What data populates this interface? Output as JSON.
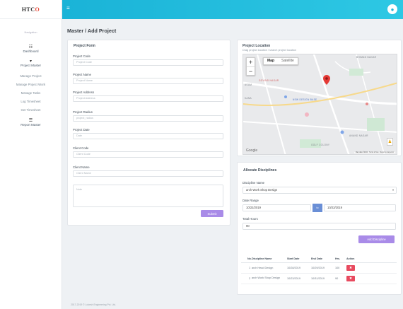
{
  "brand": {
    "prefix": "HTC",
    "accent": "O"
  },
  "sidebar": {
    "heading": "Navigation",
    "items": [
      {
        "label": "Dashboard",
        "icon": "dashboard-icon"
      },
      {
        "label": "Project Master",
        "icon": "project-icon"
      }
    ],
    "sub_items": [
      "Manage Project",
      "Manage Project Work",
      "Manage Tasks",
      "Log Timesheet",
      "Get Timesheet"
    ],
    "bottom_item": {
      "label": "Report Master",
      "icon": "report-icon"
    }
  },
  "page": {
    "title": "Master / Add Project"
  },
  "project_form": {
    "title": "Project Form",
    "fields": [
      {
        "label": "Project Code",
        "placeholder": "Project Code"
      },
      {
        "label": "Project Name",
        "placeholder": "Project Name"
      },
      {
        "label": "Project Address",
        "placeholder": "Project Address"
      },
      {
        "label": "Project Radius",
        "placeholder": "project_radius"
      },
      {
        "label": "Project Date",
        "placeholder": "Date"
      },
      {
        "label": "Client Code",
        "placeholder": "Client Code"
      },
      {
        "label": "Client Name",
        "placeholder": "Client Name"
      }
    ],
    "notes_placeholder": "Note",
    "submit_label": "Submit"
  },
  "location": {
    "title": "Project Location",
    "subtitle": "Drag project location / search project location",
    "map_type": {
      "active": "Map",
      "inactive": "Satellite"
    },
    "zoom_in": "+",
    "zoom_out": "−",
    "labels": [
      "BHIMAN NAGAR",
      "ANAND NAGAR",
      "KANA",
      "ASAM",
      "GOVIND NAGAR",
      "NEW DESIGN BASE",
      "GOLF COLONY"
    ],
    "google": "Google",
    "footer_text": "Map data ©2024 · Terms of Use · Report a map error"
  },
  "allocate": {
    "title": "Allocate Disciplines",
    "discipline_label": "Discipline Name",
    "discipline_value": "arch Work Shop Design",
    "date_range_label": "Date Range",
    "start_date": "10/22/2019",
    "to_label": "to",
    "end_date": "10/23/2019",
    "total_hours_label": "Total Hours",
    "total_hours_value": "90",
    "add_button": "Add Discipline",
    "table": {
      "headers": [
        "No.",
        "Discipline Name",
        "Start Date",
        "End Date",
        "Hrs.",
        "Action"
      ],
      "rows": [
        {
          "no": "1",
          "name": "arch Head Design",
          "start": "10/28/2019",
          "end": "10/29/2019",
          "hrs": "100"
        },
        {
          "no": "2",
          "name": "arch Work Shop Design",
          "start": "10/23/2019",
          "end": "10/31/2019",
          "hrs": "90"
        }
      ],
      "delete_symbol": "✖"
    }
  },
  "footer": {
    "text": "2017-2019 © Lokesh Engineering Pvt. Ltd."
  },
  "colors": {
    "topbar": "#1ab3d7",
    "button": "#a98be8",
    "danger": "#e84a5f",
    "accent": "#e74c3c"
  }
}
